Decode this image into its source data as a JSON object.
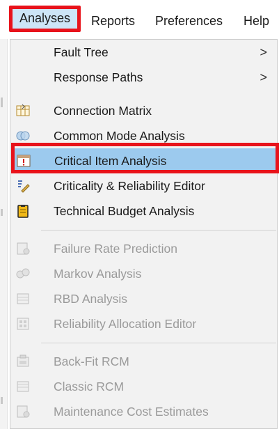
{
  "menubar": {
    "items": [
      {
        "label": "Analyses"
      },
      {
        "label": "Reports"
      },
      {
        "label": "Preferences"
      },
      {
        "label": "Help"
      }
    ]
  },
  "menu": {
    "submenus": [
      {
        "label": "Fault Tree",
        "arrow": ">"
      },
      {
        "label": "Response Paths",
        "arrow": ">"
      }
    ],
    "group1": [
      {
        "label": "Connection Matrix",
        "icon": "connection-matrix-icon"
      },
      {
        "label": "Common Mode Analysis",
        "icon": "common-mode-icon"
      },
      {
        "label": "Critical Item Analysis",
        "icon": "critical-item-icon"
      },
      {
        "label": "Criticality & Reliability Editor",
        "icon": "criticality-editor-icon"
      },
      {
        "label": "Technical Budget Analysis",
        "icon": "technical-budget-icon"
      }
    ],
    "group2": [
      {
        "label": "Failure Rate Prediction",
        "icon": "failure-rate-icon"
      },
      {
        "label": "Markov Analysis",
        "icon": "markov-icon"
      },
      {
        "label": "RBD Analysis",
        "icon": "rbd-icon"
      },
      {
        "label": "Reliability Allocation Editor",
        "icon": "reliability-allocation-icon"
      }
    ],
    "group3": [
      {
        "label": "Back-Fit RCM",
        "icon": "back-fit-rcm-icon"
      },
      {
        "label": "Classic RCM",
        "icon": "classic-rcm-icon"
      },
      {
        "label": "Maintenance Cost Estimates",
        "icon": "maintenance-cost-icon"
      }
    ]
  },
  "colors": {
    "highlight": "#9ccaee",
    "callout": "#e8131b",
    "menu_bg": "#f2f2f2",
    "disabled_text": "#9a9a9a"
  }
}
